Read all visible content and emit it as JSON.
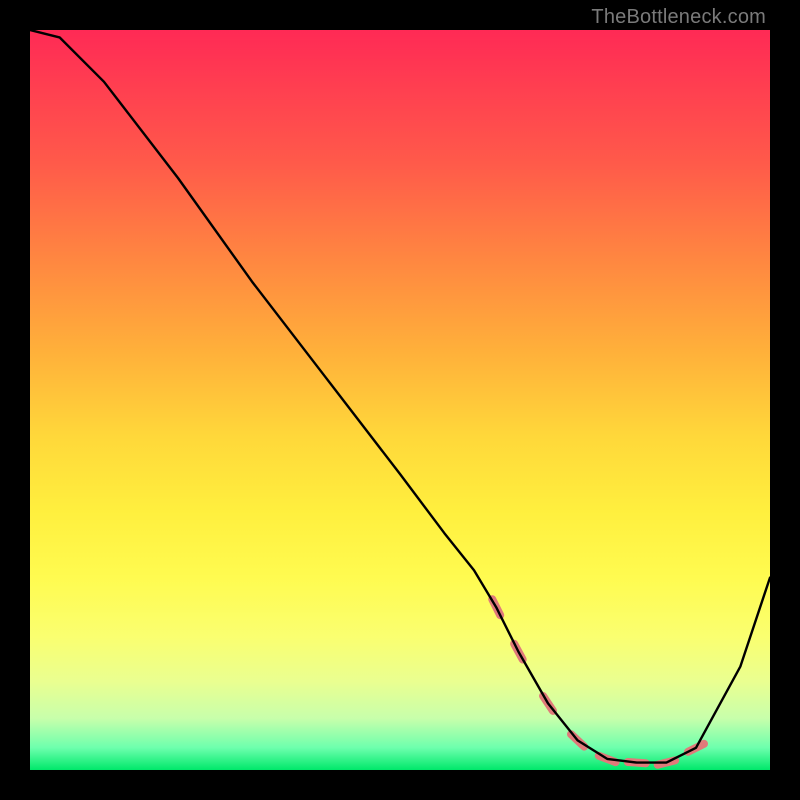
{
  "attribution": "TheBottleneck.com",
  "chart_data": {
    "type": "line",
    "title": "",
    "xlabel": "",
    "ylabel": "",
    "xlim": [
      0,
      100
    ],
    "ylim": [
      0,
      100
    ],
    "series": [
      {
        "name": "bottleneck-curve",
        "color": "#000000",
        "x": [
          0,
          4,
          10,
          20,
          30,
          40,
          50,
          56,
          60,
          63,
          66,
          70,
          74,
          78,
          82,
          86,
          90,
          96,
          100
        ],
        "y": [
          100,
          99,
          93,
          80,
          66,
          53,
          40,
          32,
          27,
          22,
          16,
          9,
          4,
          1.5,
          1,
          1,
          3,
          14,
          26
        ]
      }
    ],
    "markers": {
      "name": "highlight-band",
      "color": "#e07a7a",
      "shape": "capsule",
      "points_x": [
        63,
        66,
        70,
        74,
        78,
        82,
        86,
        90
      ],
      "points_y": [
        22,
        16,
        9,
        4,
        1.5,
        1,
        1,
        3
      ]
    },
    "gradient_stops": [
      {
        "pos": 0,
        "color": "#ff2a55"
      },
      {
        "pos": 18,
        "color": "#ff5a4a"
      },
      {
        "pos": 32,
        "color": "#ff8a40"
      },
      {
        "pos": 44,
        "color": "#ffb23a"
      },
      {
        "pos": 55,
        "color": "#ffd83a"
      },
      {
        "pos": 65,
        "color": "#ffef3e"
      },
      {
        "pos": 74,
        "color": "#fffb50"
      },
      {
        "pos": 82,
        "color": "#faff70"
      },
      {
        "pos": 88,
        "color": "#eaff90"
      },
      {
        "pos": 93,
        "color": "#c8ffab"
      },
      {
        "pos": 97,
        "color": "#6dffad"
      },
      {
        "pos": 100,
        "color": "#00e86a"
      }
    ]
  }
}
